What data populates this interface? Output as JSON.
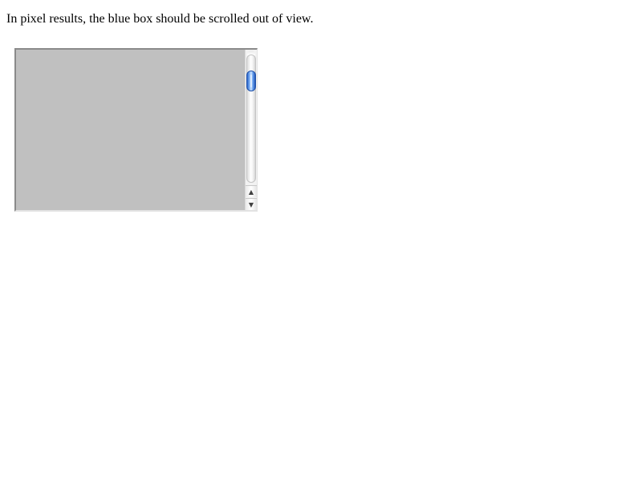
{
  "instruction": {
    "text": "In pixel results, the blue box should be scrolled out of view."
  },
  "scroll_box": {
    "background_color": "#c0c0c0",
    "scrollbar": {
      "orientation": "vertical",
      "thumb_color": "#2a63c9",
      "scroll_position_fraction": 0.15,
      "up_arrow_icon": "▲",
      "down_arrow_icon": "▼"
    }
  }
}
